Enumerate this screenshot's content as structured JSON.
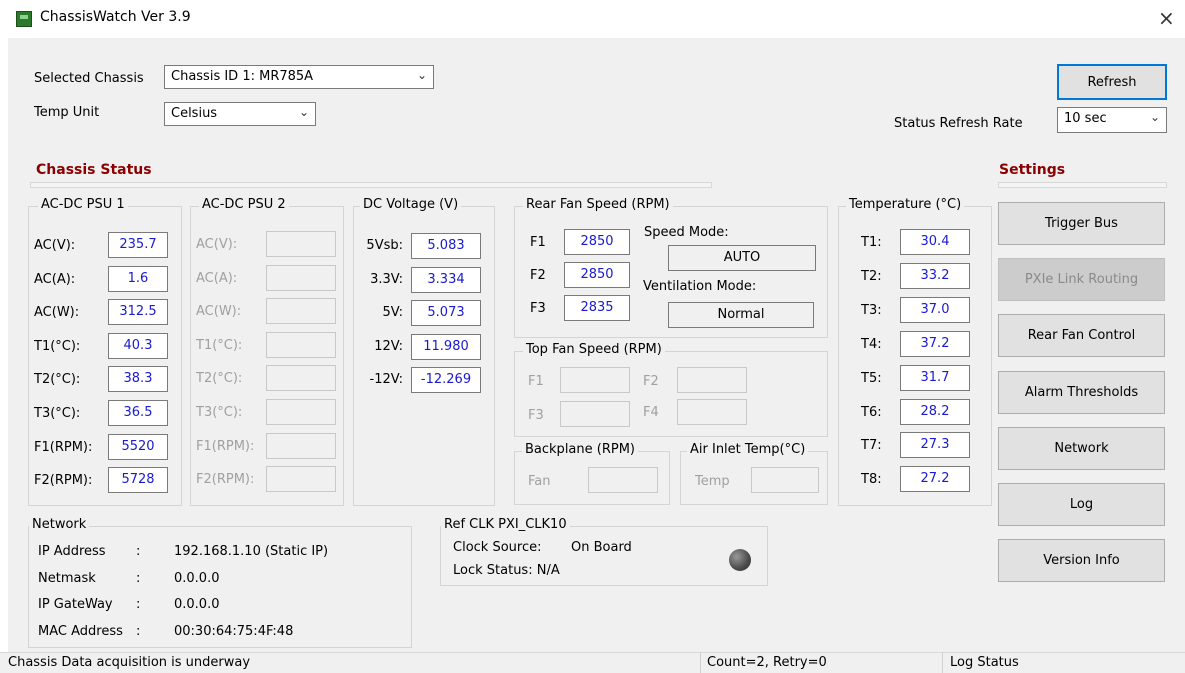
{
  "window": {
    "title": "ChassisWatch Ver 3.9",
    "close_glyph": "×"
  },
  "top": {
    "selected_chassis_label": "Selected Chassis",
    "selected_chassis_value": "Chassis ID 1: MR785A",
    "temp_unit_label": "Temp Unit",
    "temp_unit_value": "Celsius",
    "refresh_button": "Refresh",
    "status_refresh_rate_label": "Status Refresh Rate",
    "status_refresh_rate_value": "10 sec"
  },
  "chassis_status": {
    "title": "Chassis Status",
    "psu1": {
      "title": "AC-DC PSU 1",
      "rows": [
        {
          "label": "AC(V):",
          "value": "235.7"
        },
        {
          "label": "AC(A):",
          "value": "1.6"
        },
        {
          "label": "AC(W):",
          "value": "312.5"
        },
        {
          "label": "T1(°C):",
          "value": "40.3"
        },
        {
          "label": "T2(°C):",
          "value": "38.3"
        },
        {
          "label": "T3(°C):",
          "value": "36.5"
        },
        {
          "label": "F1(RPM):",
          "value": "5520"
        },
        {
          "label": "F2(RPM):",
          "value": "5728"
        }
      ]
    },
    "psu2": {
      "title": "AC-DC PSU 2",
      "rows": [
        {
          "label": "AC(V):",
          "value": ""
        },
        {
          "label": "AC(A):",
          "value": ""
        },
        {
          "label": "AC(W):",
          "value": ""
        },
        {
          "label": "T1(°C):",
          "value": ""
        },
        {
          "label": "T2(°C):",
          "value": ""
        },
        {
          "label": "T3(°C):",
          "value": ""
        },
        {
          "label": "F1(RPM):",
          "value": ""
        },
        {
          "label": "F2(RPM):",
          "value": ""
        }
      ]
    },
    "dc_voltage": {
      "title": "DC Voltage (V)",
      "rows": [
        {
          "label": "5Vsb:",
          "value": "5.083"
        },
        {
          "label": "3.3V:",
          "value": "3.334"
        },
        {
          "label": "5V:",
          "value": "5.073"
        },
        {
          "label": "12V:",
          "value": "11.980"
        },
        {
          "label": "-12V:",
          "value": "-12.269"
        }
      ]
    },
    "rear_fan": {
      "title": "Rear Fan Speed (RPM)",
      "rows": [
        {
          "label": "F1",
          "value": "2850"
        },
        {
          "label": "F2",
          "value": "2850"
        },
        {
          "label": "F3",
          "value": "2835"
        }
      ],
      "speed_mode_label": "Speed Mode:",
      "speed_mode_value": "AUTO",
      "ventilation_mode_label": "Ventilation Mode:",
      "ventilation_mode_value": "Normal"
    },
    "top_fan": {
      "title": "Top Fan Speed (RPM)",
      "f1": "F1",
      "f2": "F2",
      "f3": "F3",
      "f4": "F4"
    },
    "backplane": {
      "title": "Backplane (RPM)",
      "fan_label": "Fan"
    },
    "air_inlet": {
      "title": "Air Inlet Temp(°C)",
      "temp_label": "Temp"
    },
    "temperature": {
      "title": "Temperature (°C)",
      "rows": [
        {
          "label": "T1:",
          "value": "30.4"
        },
        {
          "label": "T2:",
          "value": "33.2"
        },
        {
          "label": "T3:",
          "value": "37.0"
        },
        {
          "label": "T4:",
          "value": "37.2"
        },
        {
          "label": "T5:",
          "value": "31.7"
        },
        {
          "label": "T6:",
          "value": "28.2"
        },
        {
          "label": "T7:",
          "value": "27.3"
        },
        {
          "label": "T8:",
          "value": "27.2"
        }
      ]
    }
  },
  "network": {
    "title": "Network",
    "rows": [
      {
        "label": "IP Address",
        "value": "192.168.1.10 (Static IP)"
      },
      {
        "label": "Netmask",
        "value": "0.0.0.0"
      },
      {
        "label": "IP GateWay",
        "value": "0.0.0.0"
      },
      {
        "label": "MAC Address",
        "value": "00:30:64:75:4F:48"
      }
    ],
    "colon": ":"
  },
  "ref_clk": {
    "title": "Ref CLK PXI_CLK10",
    "clock_source_label": "Clock Source:",
    "clock_source_value": "On Board",
    "lock_status": "Lock Status: N/A"
  },
  "settings": {
    "title": "Settings",
    "buttons": [
      "Trigger Bus",
      "PXIe Link Routing",
      "Rear Fan Control",
      "Alarm Thresholds",
      "Network",
      "Log",
      "Version Info"
    ]
  },
  "statusbar": {
    "message": "Chassis Data acquisition is underway",
    "count": "Count=2, Retry=0",
    "log_status": "Log Status"
  }
}
